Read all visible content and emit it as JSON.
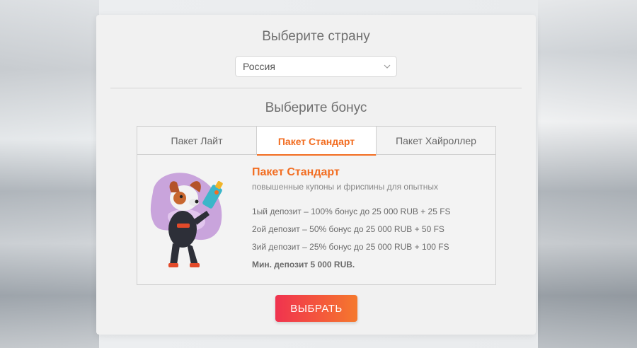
{
  "heading_country": "Выберите страну",
  "country_select": {
    "value": "Россия"
  },
  "heading_bonus": "Выберите бонус",
  "tabs": [
    {
      "label": "Пакет Лайт"
    },
    {
      "label": "Пакет Стандарт"
    },
    {
      "label": "Пакет Хайроллер"
    }
  ],
  "active_tab": 1,
  "bonus": {
    "title": "Пакет Стандарт",
    "subtitle": "повышенные купоны и фриспины для опытных",
    "deposits": [
      "1ый депозит – 100% бонус до 25 000 RUB + 25 FS",
      "2ой депозит – 50% бонус до 25 000 RUB + 50 FS",
      "3ий депозит – 25% бонус до 25 000 RUB + 100 FS"
    ],
    "min_deposit": "Мин. депозит 5 000 RUB."
  },
  "select_button": "ВЫБРАТЬ",
  "colors": {
    "accent": "#f26d21",
    "button_start": "#f0334f",
    "button_end": "#f5792d"
  }
}
